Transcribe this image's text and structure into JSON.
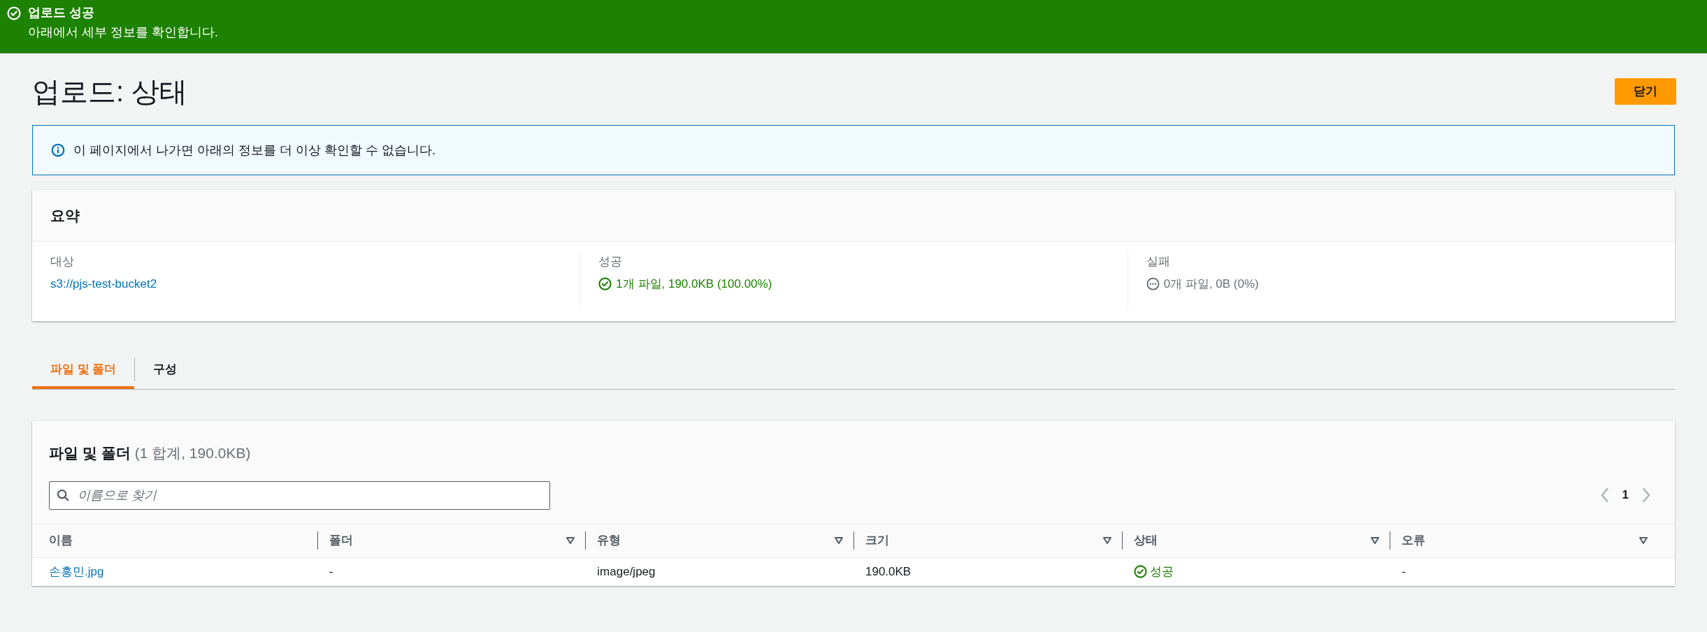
{
  "flash": {
    "kind": "success",
    "title": "업로드 성공",
    "message": "아래에서 세부 정보를 확인합니다."
  },
  "header": {
    "title": "업로드: 상태",
    "close_button": "닫기"
  },
  "info_alert": {
    "message": "이 페이지에서 나가면 아래의 정보를 더 이상 확인할 수 없습니다."
  },
  "summary": {
    "title": "요약",
    "items": [
      {
        "label": "대상",
        "value": "s3://pjs-test-bucket2",
        "kind": "link"
      },
      {
        "label": "성공",
        "value": "1개 파일, 190.0KB (100.00%)",
        "kind": "success"
      },
      {
        "label": "실패",
        "value": "0개 파일, 0B (0%)",
        "kind": "neutral"
      }
    ]
  },
  "tabs": [
    {
      "label": "파일 및 폴더",
      "selected": true
    },
    {
      "label": "구성",
      "selected": false
    }
  ],
  "table": {
    "title": "파일 및 폴더",
    "count": "(1 합계, 190.0KB)",
    "search": {
      "placeholder": "이름으로 찾기"
    },
    "pagination": {
      "page": "1"
    },
    "columns": [
      {
        "label": "이름",
        "sortable": false
      },
      {
        "label": "폴더",
        "sortable": true
      },
      {
        "label": "유형",
        "sortable": true
      },
      {
        "label": "크기",
        "sortable": true
      },
      {
        "label": "상태",
        "sortable": true
      },
      {
        "label": "오류",
        "sortable": true
      }
    ],
    "rows": [
      {
        "name": "손흥민.jpg",
        "folder": "-",
        "type": "image/jpeg",
        "size": "190.0KB",
        "status": {
          "kind": "success",
          "label": "성공"
        },
        "error": "-"
      }
    ]
  }
}
